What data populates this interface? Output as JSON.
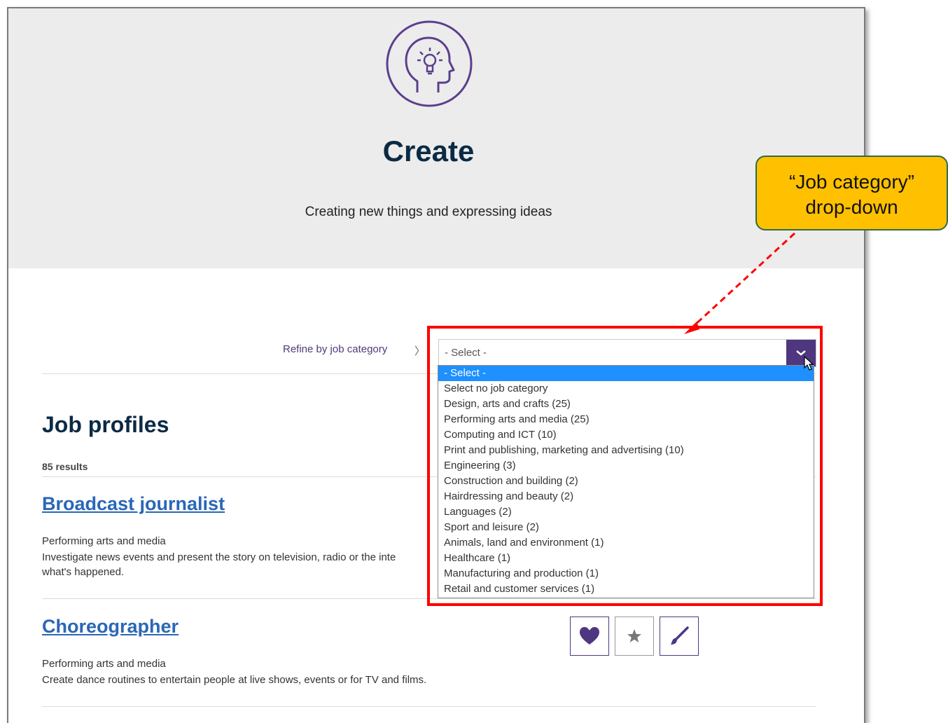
{
  "hero": {
    "title": "Create",
    "subtitle": "Creating new things and expressing ideas",
    "icon": "head-lightbulb-icon",
    "icon_color": "#5b3f8c",
    "background": "#ececec"
  },
  "filter": {
    "label": "Refine by job category",
    "chevron": "〉",
    "selected_value": "- Select -",
    "options": [
      "- Select -",
      "Select no job category",
      "Design, arts and crafts (25)",
      "Performing arts and media (25)",
      "Computing and ICT (10)",
      "Print and publishing, marketing and advertising (10)",
      "Engineering (3)",
      "Construction and building (2)",
      "Hairdressing and beauty (2)",
      "Languages (2)",
      "Sport and leisure (2)",
      "Animals, land and environment (1)",
      "Healthcare (1)",
      "Manufacturing and production (1)",
      "Retail and customer services (1)"
    ]
  },
  "results": {
    "heading": "Job profiles",
    "count_label": "85 results",
    "jobs": [
      {
        "title": "Broadcast journalist",
        "category": "Performing arts and media",
        "description_line1": "Investigate news events and present the story on television, radio or the inte",
        "description_line2": "what's happened."
      },
      {
        "title": "Choreographer",
        "category": "Performing arts and media",
        "description_line1": "Create dance routines to entertain people at live shows, events or for TV and films.",
        "icons": [
          "heart-icon",
          "star-icon",
          "paintbrush-icon"
        ]
      }
    ]
  },
  "annotation": {
    "callout_line1": "“Job category”",
    "callout_line2": "drop-down",
    "callout_color": "#ffc000",
    "highlight_color": "#ff0000"
  },
  "colors": {
    "brand_purple": "#4e3680",
    "link_blue": "#2a67b8",
    "selection_blue": "#1e90ff",
    "heading_navy": "#0b2a44"
  }
}
